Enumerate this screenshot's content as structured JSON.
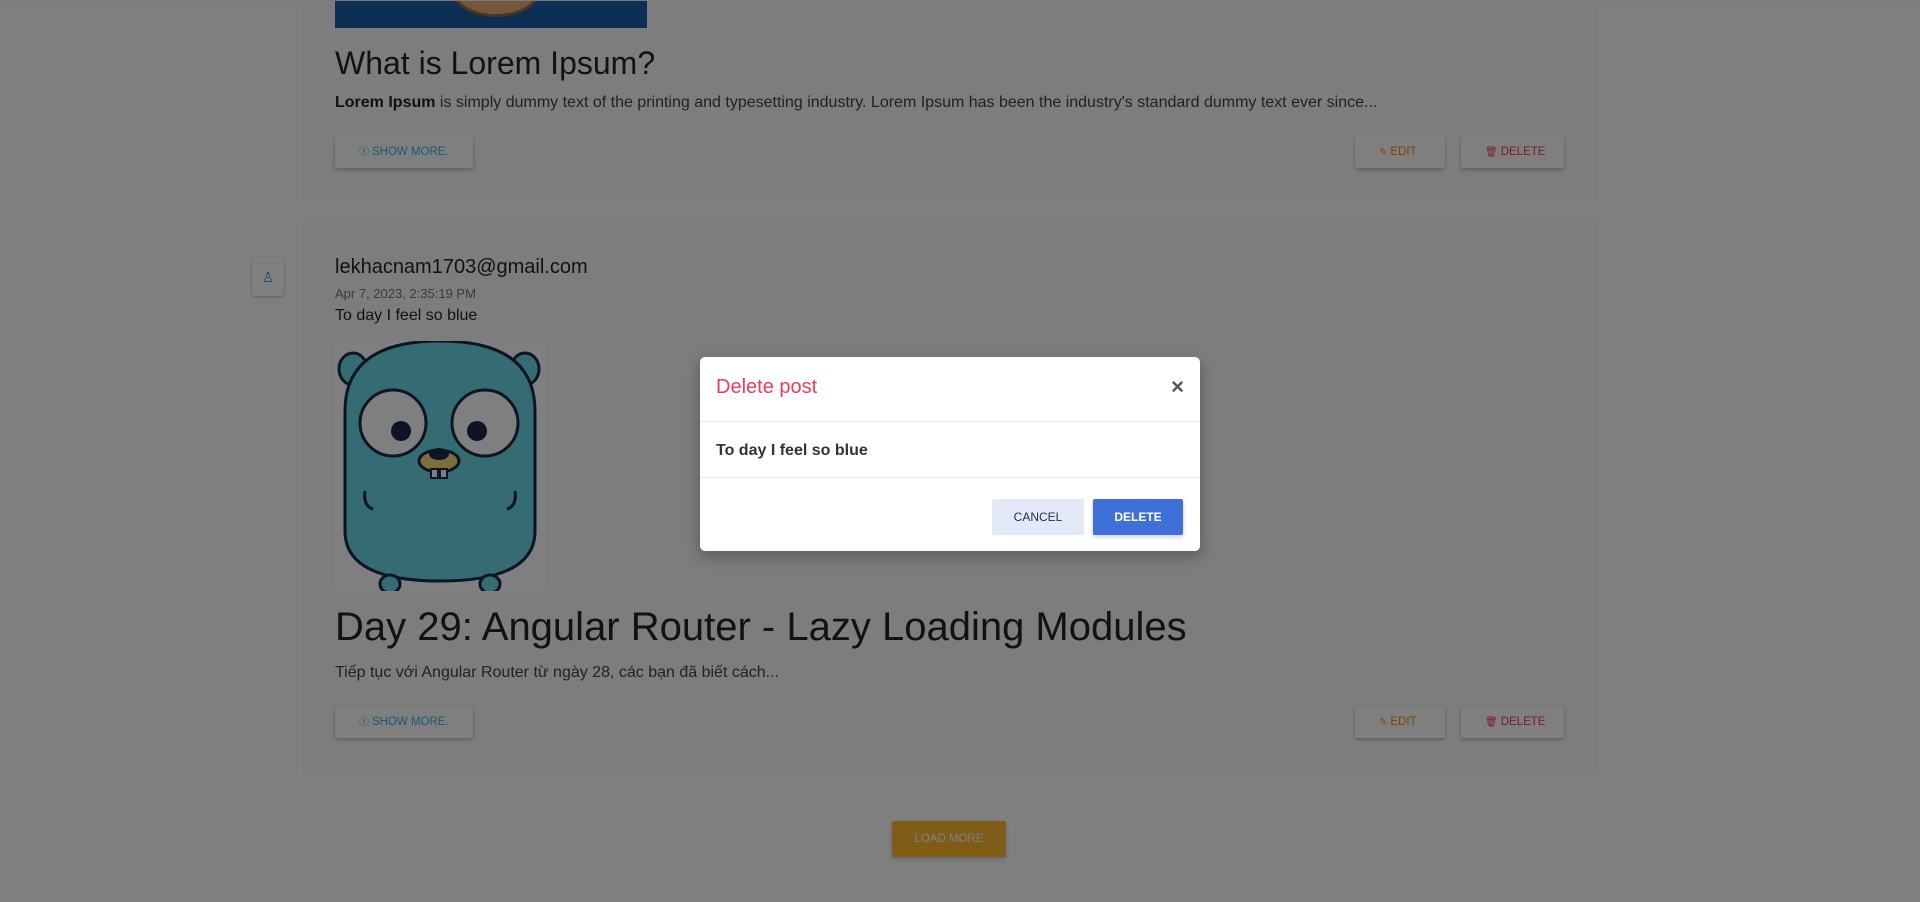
{
  "posts": [
    {
      "title": "What is Lorem Ipsum?",
      "excerpt_bold": "Lorem Ipsum",
      "excerpt_rest": " is simply dummy text of the printing and typesetting industry. Lorem Ipsum has been the industry's standard dummy text ever since...",
      "show_more_label": "SHOW MORE.",
      "edit_label": "EDIT",
      "delete_label": "DELETE"
    },
    {
      "author": "lekhacnam1703@gmail.com",
      "date": "Apr 7, 2023, 2:35:19 PM",
      "content": "To day I feel so blue",
      "title": "Day 29: Angular Router - Lazy Loading Modules",
      "excerpt": "Tiếp tục với Angular Router từ ngày 28, các bạn đã biết cách...",
      "show_more_label": "SHOW MORE.",
      "edit_label": "EDIT",
      "delete_label": "DELETE"
    }
  ],
  "load_more_label": "LOAD MORE",
  "modal": {
    "title": "Delete post",
    "close_symbol": "×",
    "body": "To day I feel so blue",
    "cancel_label": "CANCEL",
    "delete_label": "DELETE"
  },
  "icons": {
    "info": "info-circle-icon",
    "edit": "edit-icon",
    "trash": "trash-icon",
    "avatar": "user-avatar-icon"
  },
  "colors": {
    "info": "#33b5e5",
    "warning": "#ff8800",
    "danger": "#ff3547",
    "load_more": "#ffbb33",
    "modal_title": "#e83e5c",
    "primary": "#3f6fd8"
  }
}
